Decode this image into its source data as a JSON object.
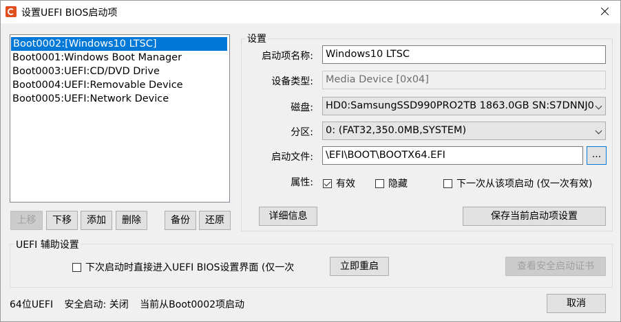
{
  "window": {
    "title": "设置UEFI BIOS启动项"
  },
  "boot_list": {
    "items": [
      {
        "label": "Boot0002:[Windows10 LTSC]",
        "selected": true
      },
      {
        "label": "Boot0001:Windows Boot Manager",
        "selected": false
      },
      {
        "label": "Boot0003:UEFI:CD/DVD Drive",
        "selected": false
      },
      {
        "label": "Boot0004:UEFI:Removable Device",
        "selected": false
      },
      {
        "label": "Boot0005:UEFI:Network Device",
        "selected": false
      }
    ]
  },
  "list_buttons": {
    "move_up": "上移",
    "move_down": "下移",
    "add": "添加",
    "delete": "删除",
    "backup": "备份",
    "restore": "还原"
  },
  "settings": {
    "group_label": "设置",
    "name_label": "启动项名称:",
    "name_value": "Windows10 LTSC",
    "device_type_label": "设备类型:",
    "device_type_value": "Media Device [0x04]",
    "disk_label": "磁盘:",
    "disk_value": "HD0:SamsungSSD990PRO2TB 1863.0GB SN:S7DNNJ0",
    "partition_label": "分区:",
    "partition_value": "0: (FAT32,350.0MB,SYSTEM)",
    "boot_file_label": "启动文件:",
    "boot_file_value": "\\EFI\\BOOT\\BOOTX64.EFI",
    "browse_button": "...",
    "attributes_label": "属性:",
    "attr_active": {
      "label": "有效",
      "checked": true
    },
    "attr_hidden": {
      "label": "隐藏",
      "checked": false
    },
    "attr_next_boot": {
      "label": "下一次从该项启动 (仅一次有效)",
      "checked": false
    },
    "details_button": "详细信息",
    "save_button": "保存当前启动项设置"
  },
  "uefi_aux": {
    "group_label": "UEFI 辅助设置",
    "enter_bios_checkbox": {
      "label": "下次启动时直接进入UEFI BIOS设置界面 (仅一次",
      "checked": false
    },
    "restart_button": "立即重启",
    "view_certs_button": "查看安全启动证书"
  },
  "status_bar": {
    "arch": "64位UEFI",
    "secure_boot": "安全启动: 关闭",
    "current_boot": "当前从Boot0002项启动"
  },
  "footer": {
    "cancel_button": "取消"
  },
  "colors": {
    "selection": "#0078d7",
    "window_bg": "#f0f0f0",
    "disabled_text": "#a0a0a0"
  },
  "icons": {
    "app": "app-logo-icon",
    "close": "close-icon",
    "dropdown": "chevron-down-icon"
  }
}
